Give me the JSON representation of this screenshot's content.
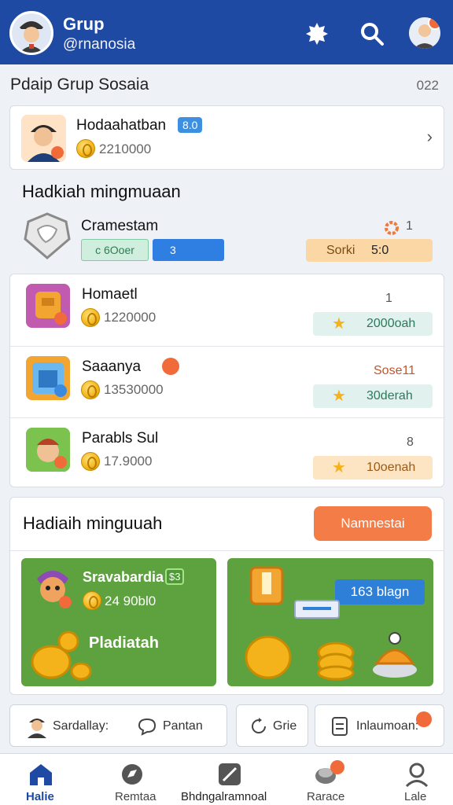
{
  "header": {
    "title": "Grup",
    "subtitle": "@rnanosia",
    "icons": [
      "gear-icon",
      "search-icon",
      "profile-avatar"
    ]
  },
  "section": {
    "title": "Pdaip Grup Sosaia",
    "count": "022"
  },
  "featured": {
    "name": "Hodaahatban",
    "badge": "8.0",
    "amount": "2210000"
  },
  "weekly_title": "Hadkiah mingmuaan",
  "progress_item": {
    "name": "Cramestam",
    "right_value": "1",
    "green_bar": "c 6Ooer",
    "blue_bar": "3",
    "orange_pill_a": "Sorki",
    "orange_pill_b": "5:0"
  },
  "list": [
    {
      "name": "Homaetl",
      "amount": "1220000",
      "right": "1",
      "pill": "2000oah",
      "pill_style": "mint"
    },
    {
      "name": "Saaanya",
      "amount": "13530000",
      "right": "Sose11",
      "pill": "30derah",
      "pill_style": "mint"
    },
    {
      "name": "Parabls Sul",
      "amount": "17.9000",
      "right": "8",
      "pill": "10oenah",
      "pill_style": "peach"
    }
  ],
  "rewards": {
    "title": "Hadiaih minguuah",
    "button": "Namnestai",
    "promo_left": {
      "name": "Sravabardia",
      "badge": "$3",
      "amount": "24 90bl0",
      "label": "Pladiatah"
    },
    "promo_right": {
      "tag": "163 blagn"
    }
  },
  "actions": [
    {
      "label": "Sardallay:"
    },
    {
      "label": "Pantan"
    },
    {
      "label": "Grie"
    },
    {
      "label": "Inlaumoan:"
    }
  ],
  "tabs": [
    {
      "label": "Halie"
    },
    {
      "label": "Remtaa"
    },
    {
      "label": "Bhdngalramnoal"
    },
    {
      "label": "Rarace"
    },
    {
      "label": "Lale"
    }
  ],
  "colors": {
    "primary": "#1f4aa3",
    "accent": "#f47c47",
    "green": "#5ea13f"
  }
}
